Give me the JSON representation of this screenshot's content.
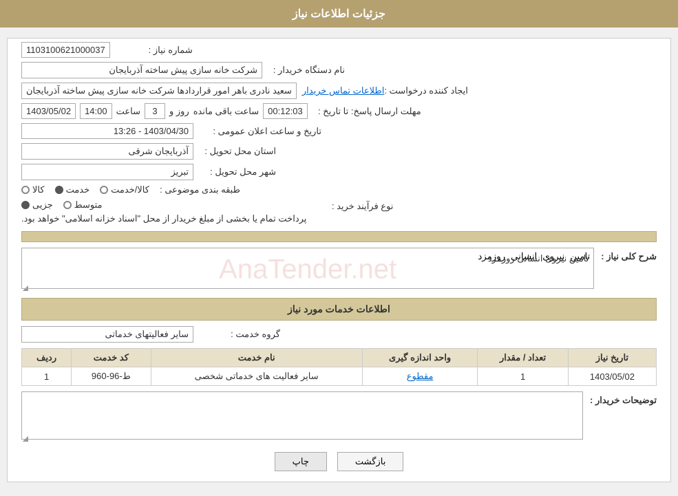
{
  "header": {
    "title": "جزئیات اطلاعات نیاز"
  },
  "fields": {
    "shomara_niaz_label": "شماره نیاز :",
    "shomara_niaz_value": "1103100621000037",
    "nam_dastgah_label": "نام دستگاه خریدار :",
    "nam_dastgah_value": "شرکت خانه سازی پیش ساخته آذربایجان",
    "ijad_konanda_label": "ایجاد کننده درخواست :",
    "ijad_konanda_value": "سعید نادری باهر امور قراردادها شرکت خانه سازی پیش ساخته آذربایجان",
    "ettelaat_link": "اطلاعات تماس خریدار",
    "mohlat_label": "مهلت ارسال پاسخ: تا تاریخ :",
    "tarikh_value": "1403/05/02",
    "saat_value": "14:00",
    "rooz_value": "3",
    "baqi_value": "00:12:03",
    "baqi_text": "ساعت باقی مانده",
    "tarikh_saat_label": "تاریخ و ساعت اعلان عمومی :",
    "tarikh_saat_value": "1403/04/30 - 13:26",
    "ostan_label": "استان محل تحویل :",
    "ostan_value": "آذربایجان شرقی",
    "shahr_label": "شهر محل تحویل :",
    "shahr_value": "تبریز",
    "tabaqe_label": "طبقه بندی موضوعی :",
    "tabaqe_options": [
      "کالا",
      "خدمت",
      "کالا/خدمت"
    ],
    "tabaqe_selected": "خدمت",
    "noe_farayand_label": "نوع فرآیند خرید :",
    "noe_options": [
      "جزیی",
      "متوسط"
    ],
    "noe_selected": "جزیی",
    "noe_text": "پرداخت تمام یا بخشی از مبلغ خریدار از محل \"اسناد خزانه اسلامی\" خواهد بود.",
    "sharh_label": "شرح کلی نیاز :",
    "sharh_value": "تامین نیروی انسانی روزمزد",
    "services_header": "اطلاعات خدمات مورد نیاز",
    "grohe_label": "گروه خدمت :",
    "grohe_value": "سایر فعالیتهای خدماتی",
    "table": {
      "headers": [
        "ردیف",
        "کد خدمت",
        "نام خدمت",
        "واحد اندازه گیری",
        "تعداد / مقدار",
        "تاریخ نیاز"
      ],
      "rows": [
        {
          "radif": "1",
          "kod": "ط-96-960",
          "nam": "سایر فعالیت های خدماتی شخصی",
          "vahed": "مقطوع",
          "tedad": "1",
          "tarikh": "1403/05/02"
        }
      ]
    },
    "tosihaat_label": "توضیحات خریدار :",
    "tosihaat_value": "",
    "btn_print": "چاپ",
    "btn_back": "بازگشت"
  }
}
